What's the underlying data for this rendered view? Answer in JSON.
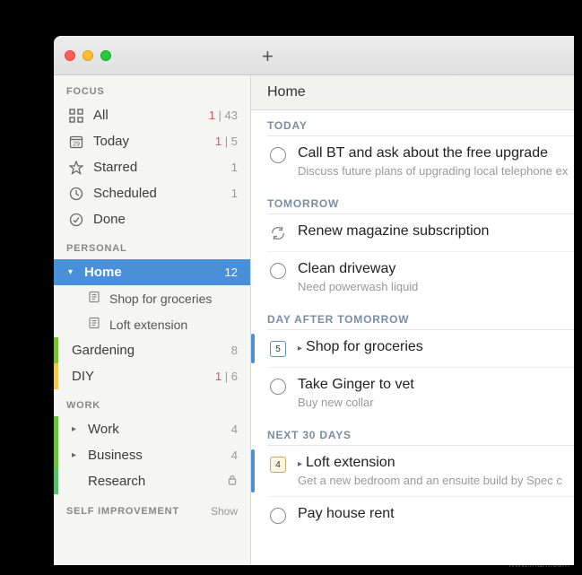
{
  "titlebar": {
    "plus": "+"
  },
  "sidebar": {
    "sections": {
      "focus": {
        "label": "FOCUS"
      },
      "personal": {
        "label": "PERSONAL"
      },
      "work": {
        "label": "WORK"
      },
      "self_improvement": {
        "label": "SELF IMPROVEMENT",
        "show": "Show"
      }
    },
    "focus_items": {
      "all": {
        "label": "All",
        "overdue": "1",
        "sep": " | ",
        "count": "43"
      },
      "today": {
        "label": "Today",
        "overdue": "1",
        "sep": " | ",
        "count": "5",
        "cal_day": "29"
      },
      "starred": {
        "label": "Starred",
        "count": "1"
      },
      "scheduled": {
        "label": "Scheduled",
        "count": "1"
      },
      "done": {
        "label": "Done"
      }
    },
    "personal_items": {
      "home": {
        "label": "Home",
        "count": "12"
      },
      "home_sub1": {
        "label": "Shop for groceries"
      },
      "home_sub2": {
        "label": "Loft extension"
      },
      "gardening": {
        "label": "Gardening",
        "count": "8"
      },
      "diy": {
        "label": "DIY",
        "overdue": "1",
        "sep": " | ",
        "count": "6"
      }
    },
    "work_items": {
      "work": {
        "label": "Work",
        "count": "4"
      },
      "business": {
        "label": "Business",
        "count": "4"
      },
      "research": {
        "label": "Research"
      }
    }
  },
  "main": {
    "header": "Home",
    "groups": {
      "today": {
        "label": "TODAY",
        "t1": {
          "title": "Call BT and ask about the free upgrade",
          "note": "Discuss future plans of upgrading local telephone ex"
        }
      },
      "tomorrow": {
        "label": "TOMORROW",
        "t1": {
          "title": "Renew magazine subscription"
        },
        "t2": {
          "title": "Clean driveway",
          "note": "Need powerwash liquid"
        }
      },
      "day_after": {
        "label": "DAY AFTER TOMORROW",
        "t1": {
          "title": "Shop for groceries",
          "badge": "5"
        },
        "t2": {
          "title": "Take Ginger to vet",
          "note": "Buy new collar"
        }
      },
      "next30": {
        "label": "NEXT 30 DAYS",
        "t1": {
          "title": "Loft extension",
          "badge": "4",
          "note": "Get a new bedroom and an ensuite build by Spec c"
        },
        "t2": {
          "title": "Pay house rent"
        }
      }
    }
  },
  "watermark": "www.frfam.com"
}
